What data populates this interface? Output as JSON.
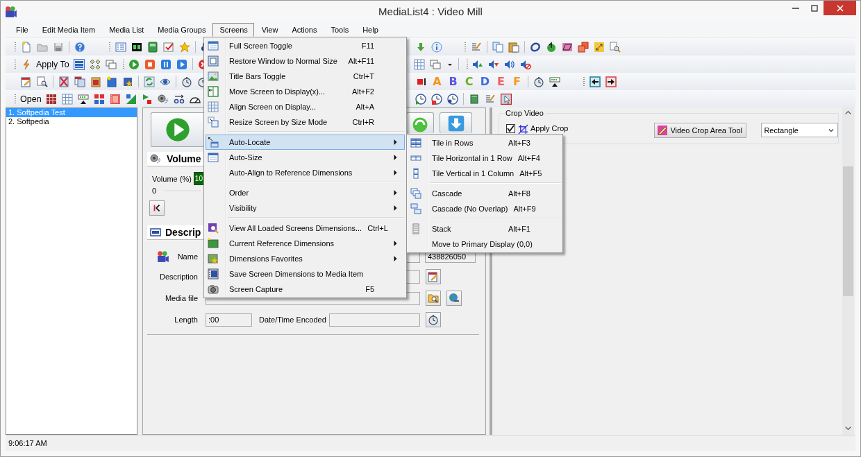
{
  "window": {
    "title": "MediaList4 : Video Mill"
  },
  "menu_bar": [
    {
      "label": "File",
      "selected": false
    },
    {
      "label": "Edit Media Item",
      "selected": false
    },
    {
      "label": "Media List",
      "selected": false
    },
    {
      "label": "Media Groups",
      "selected": false
    },
    {
      "label": "Screens",
      "selected": true
    },
    {
      "label": "View",
      "selected": false
    },
    {
      "label": "Actions",
      "selected": false
    },
    {
      "label": "Tools",
      "selected": false
    },
    {
      "label": "Help",
      "selected": false
    }
  ],
  "toolbar": {
    "apply_to_label": "Apply To",
    "open_label": "Open",
    "letter_buttons": [
      {
        "label": "A",
        "color": "#f7941d"
      },
      {
        "label": "B",
        "color": "#5a5ae6"
      },
      {
        "label": "C",
        "color": "#6ab023"
      },
      {
        "label": "D",
        "color": "#3d6be6"
      },
      {
        "label": "E",
        "color": "#f06060"
      },
      {
        "label": "F",
        "color": "#f79a1d"
      }
    ]
  },
  "media_list": {
    "items": [
      {
        "label": "1. Softpedia Test",
        "selected": true
      },
      {
        "label": "2. Softpedia",
        "selected": false
      }
    ]
  },
  "volume_section": {
    "title": "Volume",
    "volume_label": "Volume (%)",
    "volume_value": "10",
    "slider_min": "0"
  },
  "description_section": {
    "title": "Descrip",
    "name_label": "Name",
    "name_field_2": "438826050",
    "description_label": "Description",
    "media_file_label": "Media file",
    "length_label": "Length",
    "length_value": ":00",
    "date_label": "Date/Time Encoded"
  },
  "crop": {
    "group_title": "Crop Video",
    "apply_crop": {
      "label": "Apply Crop",
      "checked": true
    },
    "area_tool_button": "Video Crop Area Tool",
    "shape_select": "Rectangle"
  },
  "screens_menu": {
    "items": [
      {
        "kind": "item",
        "label": "Full Screen Toggle",
        "shortcut": "F11",
        "submenu": false,
        "selected": false
      },
      {
        "kind": "item",
        "label": "Restore Window to Normal Size",
        "shortcut": "Alt+F11",
        "submenu": false,
        "selected": false
      },
      {
        "kind": "item",
        "label": "Title Bars Toggle",
        "shortcut": "Ctrl+T",
        "submenu": false,
        "selected": false
      },
      {
        "kind": "item",
        "label": "Move Screen to Display(x)...",
        "shortcut": "Alt+F2",
        "submenu": false,
        "selected": false
      },
      {
        "kind": "item",
        "label": "Align Screen on Display...",
        "shortcut": "Alt+A",
        "submenu": false,
        "selected": false
      },
      {
        "kind": "item",
        "label": "Resize Screen by Size Mode",
        "shortcut": "Ctrl+R",
        "submenu": false,
        "selected": false
      },
      {
        "kind": "separator"
      },
      {
        "kind": "item",
        "label": "Auto-Locate",
        "submenu": true,
        "selected": true
      },
      {
        "kind": "item",
        "label": "Auto-Size",
        "submenu": true,
        "selected": false
      },
      {
        "kind": "item",
        "label": "Auto-Align to Reference Dimensions",
        "submenu": true,
        "selected": false
      },
      {
        "kind": "separator"
      },
      {
        "kind": "item",
        "label": "Order",
        "submenu": true,
        "selected": false
      },
      {
        "kind": "item",
        "label": "Visibility",
        "submenu": true,
        "selected": false
      },
      {
        "kind": "separator"
      },
      {
        "kind": "item",
        "label": "View All Loaded Screens Dimensions...",
        "shortcut": "Ctrl+L",
        "submenu": false,
        "selected": false
      },
      {
        "kind": "item",
        "label": "Current Reference Dimensions",
        "submenu": true,
        "selected": false
      },
      {
        "kind": "item",
        "label": "Dimensions Favorites",
        "submenu": true,
        "selected": false
      },
      {
        "kind": "item",
        "label": "Save Screen Dimensions to Media Item",
        "submenu": false,
        "selected": false
      },
      {
        "kind": "item",
        "label": "Screen Capture",
        "shortcut": "F5",
        "submenu": false,
        "selected": false
      }
    ]
  },
  "auto_locate_submenu": {
    "items": [
      {
        "kind": "item",
        "label": "Tile in Rows",
        "shortcut": "Alt+F3",
        "submenu": false,
        "selected": false
      },
      {
        "kind": "item",
        "label": "Tile Horizontal in 1 Row",
        "shortcut": "Alt+F4",
        "submenu": false,
        "selected": false
      },
      {
        "kind": "item",
        "label": "Tile Vertical in 1 Column",
        "shortcut": "Alt+F5",
        "submenu": false,
        "selected": false
      },
      {
        "kind": "separator"
      },
      {
        "kind": "item",
        "label": "Cascade",
        "shortcut": "Alt+F8",
        "submenu": false,
        "selected": false
      },
      {
        "kind": "item",
        "label": "Cascade (No Overlap)",
        "shortcut": "Alt+F9",
        "submenu": false,
        "selected": false
      },
      {
        "kind": "separator"
      },
      {
        "kind": "item",
        "label": "Stack",
        "shortcut": "Alt+F1",
        "submenu": false,
        "selected": false
      },
      {
        "kind": "item",
        "label": "Move to Primary Display (0,0)",
        "submenu": false,
        "selected": false
      }
    ]
  },
  "status_bar": {
    "time": "9:06:17 AM"
  }
}
